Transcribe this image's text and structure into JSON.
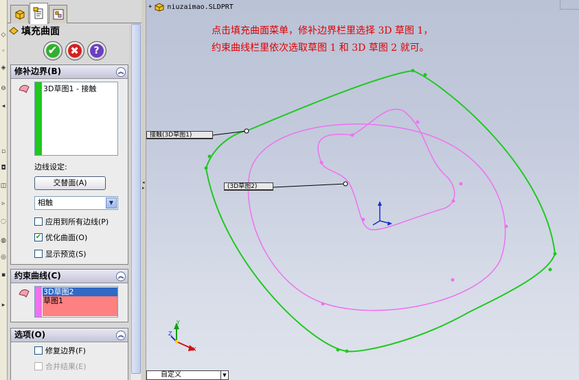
{
  "panel": {
    "title": "填充曲面",
    "help_glyph": "?",
    "buttons": {
      "ok": "✔",
      "cancel": "✖",
      "help": "?"
    }
  },
  "patch_boundary": {
    "header": "修补边界(B)",
    "items": [
      "3D草图1 - 接触"
    ],
    "edge_settings_label": "边线设定:",
    "alternate_face_button": "交替面(A)",
    "condition_value": "相触",
    "checkboxes": [
      {
        "label": "应用到所有边线(P)",
        "checked": false
      },
      {
        "label": "优化曲面(O)",
        "checked": true
      },
      {
        "label": "显示预览(S)",
        "checked": false
      }
    ]
  },
  "constraint_curves": {
    "header": "约束曲线(C)",
    "items": [
      {
        "label": "3D草图2",
        "selected": true
      },
      {
        "label": "草图1",
        "selected": false
      }
    ]
  },
  "options": {
    "header": "选项(O)",
    "checkboxes": [
      {
        "label": "修复边界(F)",
        "checked": false,
        "enabled": true
      },
      {
        "label": "合并结果(E)",
        "checked": false,
        "enabled": false
      }
    ]
  },
  "viewport": {
    "tree_root": "niuzaimao.SLDPRT",
    "note_lines": [
      "点击填充曲面菜单，修补边界栏里选择 3D 草图 1，",
      "约束曲线栏里依次选取草图 1 和 3D 草图 2 就可。"
    ],
    "callout_contact": "接触(3D草图1)",
    "callout_sketch2": "(3D草图2)",
    "view_orientation": "自定义",
    "triad_labels": {
      "x": "X",
      "y": "Y",
      "z": "Z"
    }
  },
  "colors": {
    "boundary_curve": "#1fc81f",
    "constraint_curve": "#f070f0",
    "note_text": "#e00000",
    "list_selected": "#316ac5",
    "list_highlight": "#ff8080"
  },
  "icons": {
    "tabs": [
      "feature-manager-icon",
      "property-manager-icon",
      "configuration-manager-icon"
    ],
    "feature": "fill-surface-icon",
    "selection": "surface-selection-icon"
  }
}
